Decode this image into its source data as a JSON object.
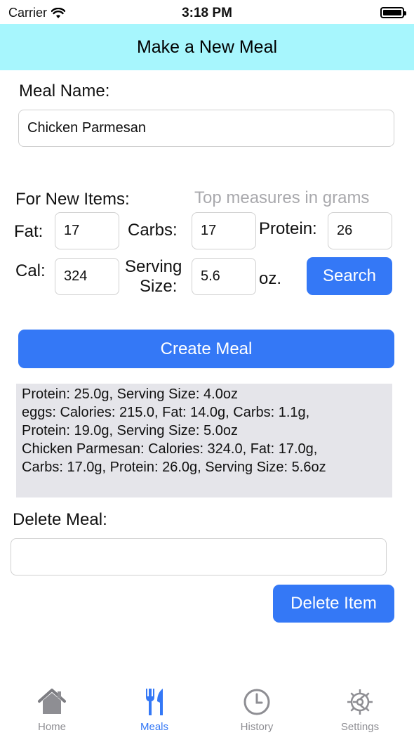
{
  "status_bar": {
    "carrier": "Carrier",
    "time": "3:18 PM"
  },
  "navbar": {
    "title": "Make a New Meal"
  },
  "meal_name": {
    "label": "Meal Name:",
    "value": "Chicken Parmesan"
  },
  "new_items": {
    "label": "For New Items:",
    "hint": "Top measures in grams",
    "fat": {
      "label": "Fat:",
      "value": "17"
    },
    "carbs": {
      "label": "Carbs:",
      "value": "17"
    },
    "protein": {
      "label": "Protein:",
      "value": "26"
    },
    "cal": {
      "label": "Cal:",
      "value": "324"
    },
    "serving": {
      "label_line1": "Serving",
      "label_line2": "Size:",
      "value": "5.6",
      "unit": "oz."
    },
    "search_label": "Search"
  },
  "create_meal_label": "Create Meal",
  "meal_log": [
    "Protein: 25.0g, Serving Size: 4.0oz",
    "eggs: Calories: 215.0, Fat: 14.0g, Carbs: 1.1g,",
    "Protein: 19.0g, Serving Size: 5.0oz",
    "Chicken Parmesan: Calories: 324.0, Fat: 17.0g,",
    "Carbs: 17.0g, Protein: 26.0g, Serving Size: 5.6oz"
  ],
  "delete_meal": {
    "label": "Delete Meal:",
    "value": "",
    "button_label": "Delete Item"
  },
  "tabs": [
    {
      "label": "Home",
      "icon": "home-icon",
      "active": false
    },
    {
      "label": "Meals",
      "icon": "fork-knife-icon",
      "active": true
    },
    {
      "label": "History",
      "icon": "clock-icon",
      "active": false
    },
    {
      "label": "Settings",
      "icon": "gear-icon",
      "active": false
    }
  ],
  "colors": {
    "accent": "#3478f6",
    "navbar_bg": "#a7f6fd",
    "log_bg": "#e5e5ea",
    "tab_inactive": "#8e8e93"
  }
}
